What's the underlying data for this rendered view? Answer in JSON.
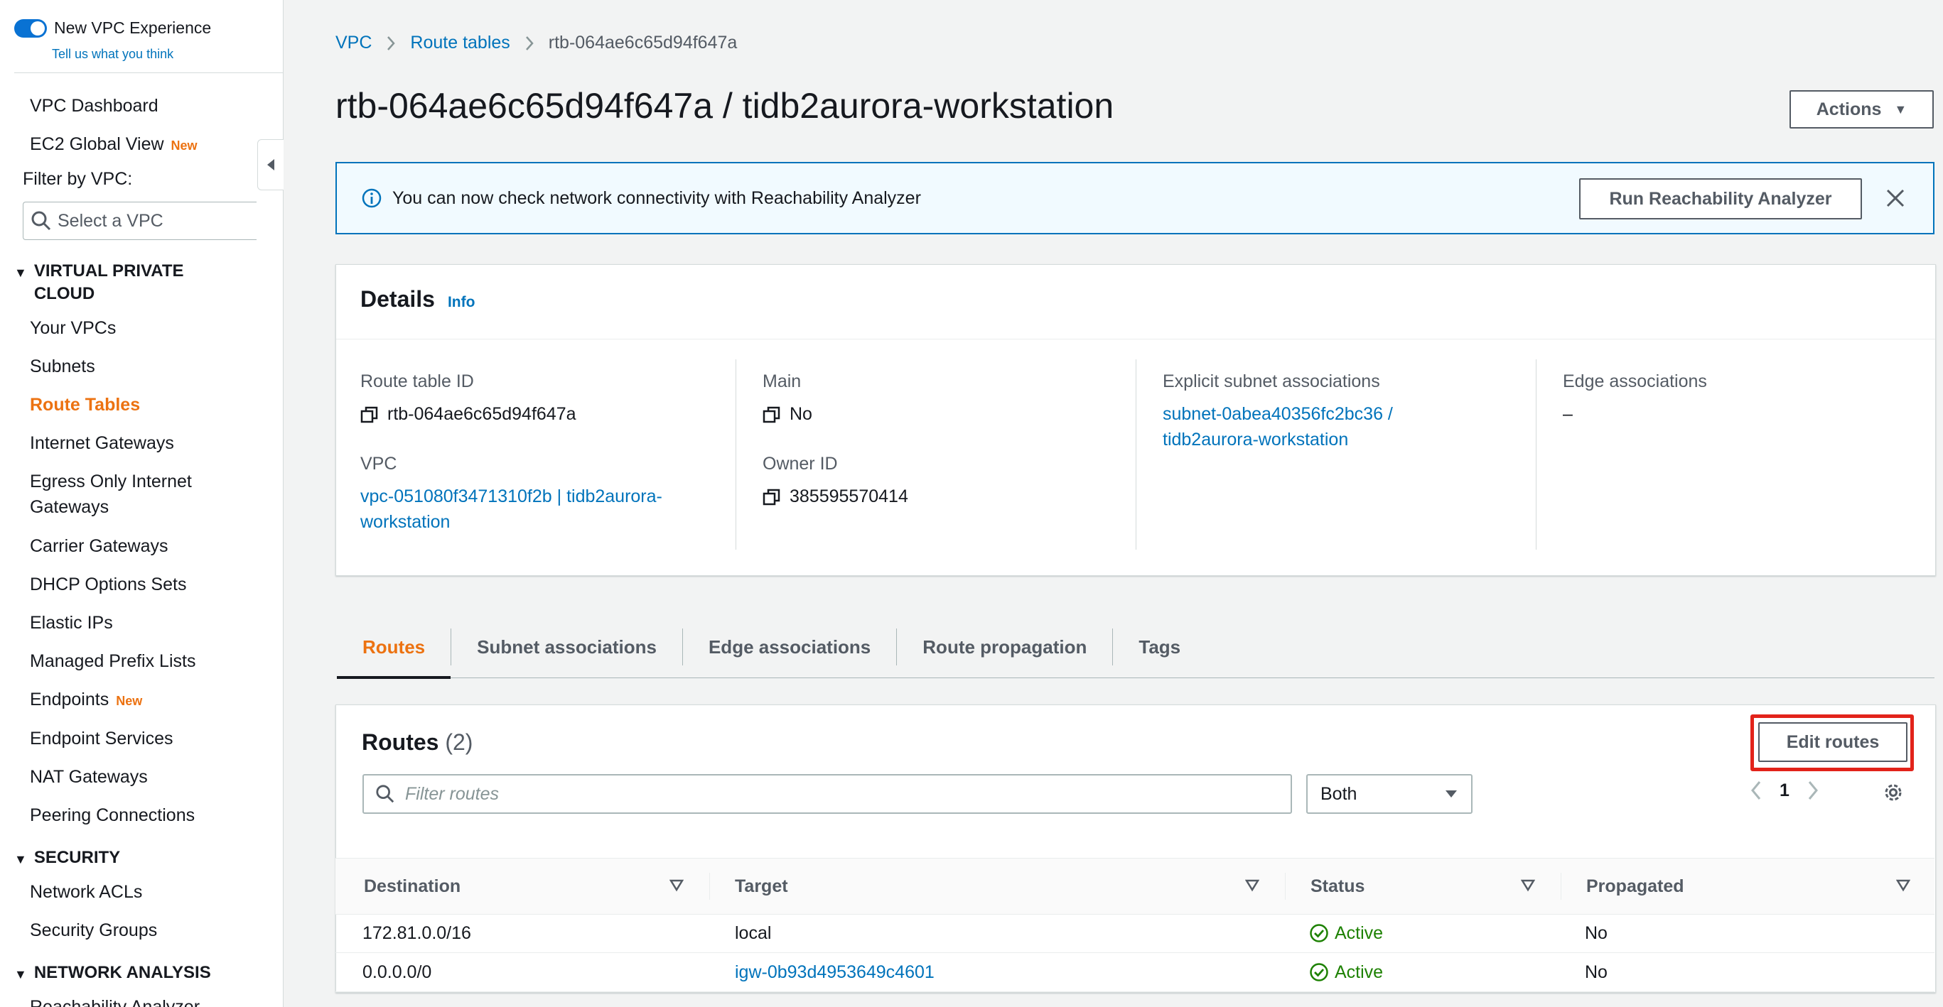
{
  "sidebar": {
    "toggle_label": "New VPC Experience",
    "feedback_link": "Tell us what you think",
    "top_items": [
      {
        "label": "VPC Dashboard",
        "badge": ""
      },
      {
        "label": "EC2 Global View",
        "badge": "New"
      }
    ],
    "filter_label": "Filter by VPC:",
    "filter_placeholder": "Select a VPC",
    "sections": [
      {
        "title": "VIRTUAL PRIVATE CLOUD",
        "items": [
          {
            "label": "Your VPCs",
            "badge": ""
          },
          {
            "label": "Subnets",
            "badge": ""
          },
          {
            "label": "Route Tables",
            "badge": "",
            "active": true
          },
          {
            "label": "Internet Gateways",
            "badge": ""
          },
          {
            "label": "Egress Only Internet Gateways",
            "badge": ""
          },
          {
            "label": "Carrier Gateways",
            "badge": ""
          },
          {
            "label": "DHCP Options Sets",
            "badge": ""
          },
          {
            "label": "Elastic IPs",
            "badge": ""
          },
          {
            "label": "Managed Prefix Lists",
            "badge": ""
          },
          {
            "label": "Endpoints",
            "badge": "New"
          },
          {
            "label": "Endpoint Services",
            "badge": ""
          },
          {
            "label": "NAT Gateways",
            "badge": ""
          },
          {
            "label": "Peering Connections",
            "badge": ""
          }
        ]
      },
      {
        "title": "SECURITY",
        "items": [
          {
            "label": "Network ACLs",
            "badge": ""
          },
          {
            "label": "Security Groups",
            "badge": ""
          }
        ]
      },
      {
        "title": "NETWORK ANALYSIS",
        "items": [
          {
            "label": "Reachability Analyzer",
            "badge": ""
          }
        ]
      }
    ]
  },
  "breadcrumb": [
    "VPC",
    "Route tables",
    "rtb-064ae6c65d94f647a"
  ],
  "page_title": "rtb-064ae6c65d94f647a / tidb2aurora-workstation",
  "actions_label": "Actions",
  "banner": {
    "message": "You can now check network connectivity with Reachability Analyzer",
    "button": "Run Reachability Analyzer"
  },
  "details": {
    "title": "Details",
    "info": "Info",
    "route_table_id_label": "Route table ID",
    "route_table_id": "rtb-064ae6c65d94f647a",
    "vpc_label": "VPC",
    "vpc_line1": "vpc-051080f3471310f2b | tidb2aurora-",
    "vpc_line2": "workstation",
    "main_label": "Main",
    "main": "No",
    "owner_label": "Owner ID",
    "owner": "385595570414",
    "explicit_label": "Explicit subnet associations",
    "explicit_line1": "subnet-0abea40356fc2bc36 /",
    "explicit_line2": "tidb2aurora-workstation",
    "edge_label": "Edge associations",
    "edge": "–"
  },
  "tabs": [
    "Routes",
    "Subnet associations",
    "Edge associations",
    "Route propagation",
    "Tags"
  ],
  "routes": {
    "title": "Routes",
    "count": "(2)",
    "edit_button": "Edit routes",
    "filter_placeholder": "Filter routes",
    "select_value": "Both",
    "page": "1",
    "columns": [
      "Destination",
      "Target",
      "Status",
      "Propagated"
    ],
    "rows": [
      {
        "destination": "172.81.0.0/16",
        "target": "local",
        "target_link": false,
        "status": "Active",
        "propagated": "No"
      },
      {
        "destination": "0.0.0.0/0",
        "target": "igw-0b93d4953649c4601",
        "target_link": true,
        "status": "Active",
        "propagated": "No"
      }
    ]
  },
  "colors": {
    "link": "#0073bb",
    "accent_orange": "#ec7211",
    "status_green": "#1d8102",
    "highlight_red": "#e2231a"
  }
}
